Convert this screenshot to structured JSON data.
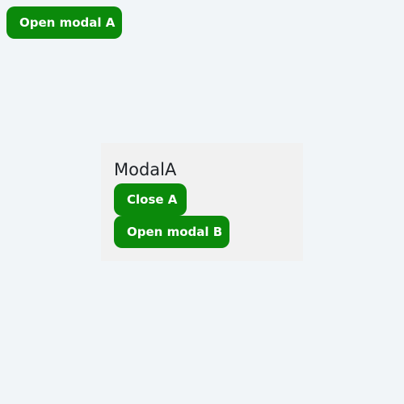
{
  "page": {
    "background": "#f1f5f8",
    "accent": "#0b8a0b"
  },
  "toolbar": {
    "open_modal_a_label": "Open modal A"
  },
  "modal_a": {
    "title": "ModalA",
    "close_label": "Close A",
    "open_modal_b_label": "Open modal B"
  }
}
